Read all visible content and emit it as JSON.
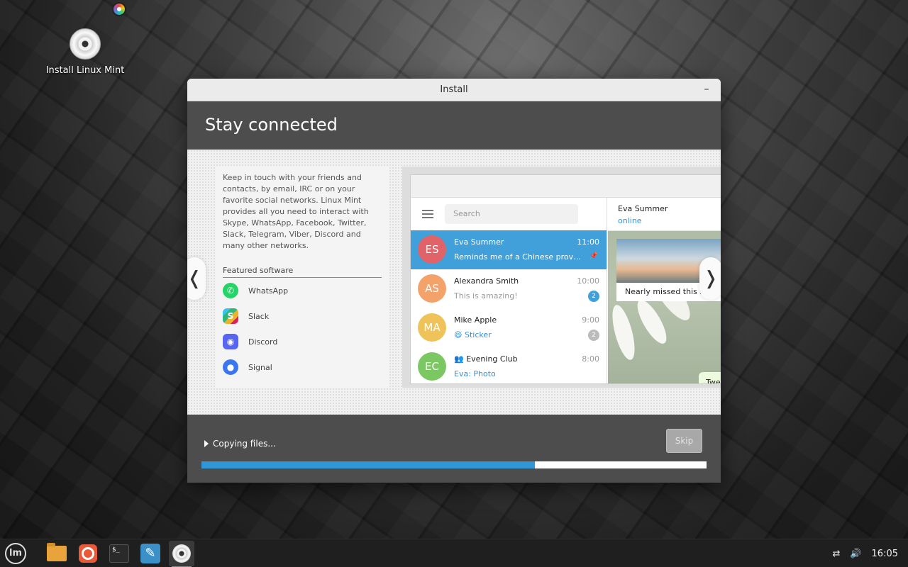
{
  "desktop": {
    "icon_label": "Install Linux Mint"
  },
  "window": {
    "title": "Install",
    "minimize_glyph": "–",
    "heading": "Stay connected",
    "description": "Keep in touch with your friends and contacts, by email, IRC or on your favorite social networks. Linux Mint provides all you need to interact with Skype, WhatsApp, Facebook, Twitter, Slack, Telegram, Viber, Discord and many other networks.",
    "featured_title": "Featured software",
    "software": [
      {
        "name": "WhatsApp",
        "icon": "whatsapp-icon",
        "color": "#25d366"
      },
      {
        "name": "Slack",
        "icon": "slack-icon",
        "color": "#4a154b"
      },
      {
        "name": "Discord",
        "icon": "discord-icon",
        "color": "#5865f2"
      },
      {
        "name": "Signal",
        "icon": "signal-icon",
        "color": "#3a76f0"
      }
    ],
    "prev_glyph": "❬",
    "next_glyph": "❭",
    "status_text": "Copying files...",
    "skip_label": "Skip",
    "progress_percent": 66,
    "accent_color": "#3197d9"
  },
  "mockup": {
    "search_placeholder": "Search",
    "chats": [
      {
        "initials": "ES",
        "name": "Eva Summer",
        "time": "11:00",
        "message": "Reminds me of a Chinese proverb",
        "selected": true,
        "avatar_color": "#e0636a",
        "pinned": true
      },
      {
        "initials": "AS",
        "name": "Alexandra Smith",
        "time": "10:00",
        "message": "This is amazing!",
        "badge": "2",
        "avatar_color": "#f3a26a"
      },
      {
        "initials": "MA",
        "name": "Mike Apple",
        "time": "9:00",
        "message": "😄 Sticker",
        "badge": "2",
        "badge_grey": true,
        "avatar_color": "#f0c35a"
      },
      {
        "initials": "EC",
        "name": "Evening Club",
        "time": "8:00",
        "message": "Eva: Photo",
        "avatar_color": "#7bc862"
      }
    ],
    "convo_name": "Eva Summer",
    "convo_status": "online",
    "photo_caption": "Nearly missed this s",
    "bubble_text": "Twe"
  },
  "taskbar": {
    "clock": "16:05",
    "menu_logo": "lm",
    "terminal_text": "$_"
  }
}
